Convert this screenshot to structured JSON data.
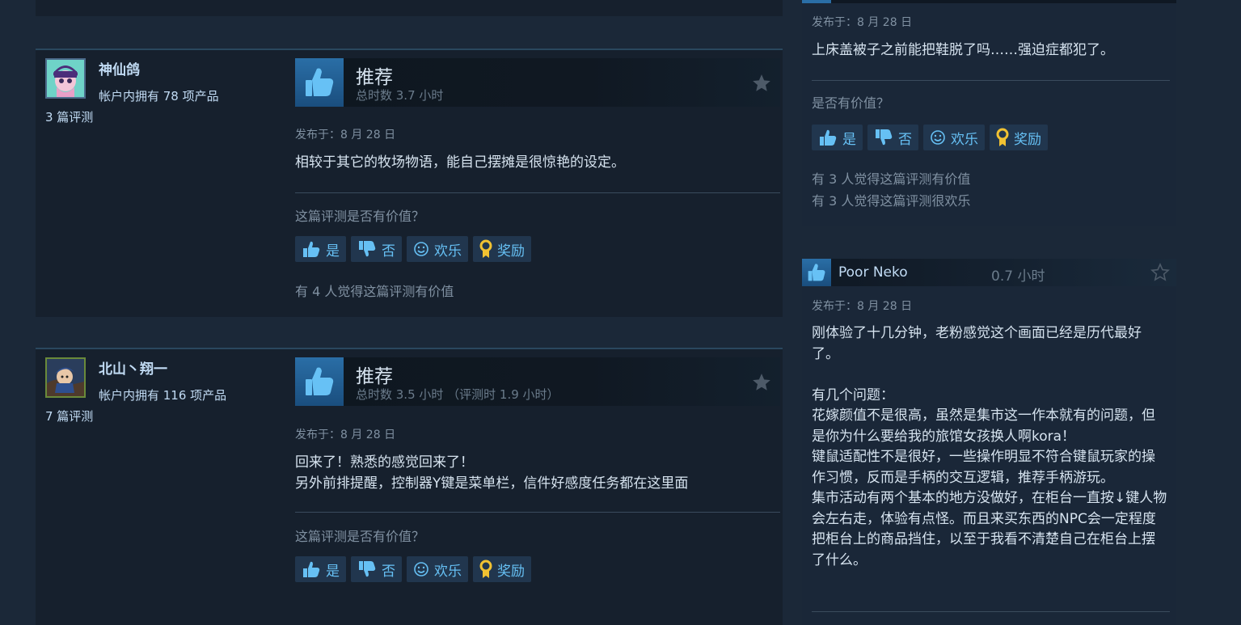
{
  "colors": {
    "background": "#1b2838",
    "card": "#16202d",
    "accent_blue": "#66c0f4",
    "award_gold": "#f1c232"
  },
  "reviews": [
    {
      "persona": "神仙鸽",
      "owned": "帐户内拥有 78 项产品",
      "review_count": "3 篇评测",
      "verdict": "推荐",
      "hours": "总时数 3.7 小时",
      "posted": "发布于：8 月 28 日",
      "body": "相较于其它的牧场物语，能自己摆摊是很惊艳的设定。",
      "helpful_question": "这篇评测是否有价值？",
      "buttons": {
        "yes": "是",
        "no": "否",
        "funny": "欢乐",
        "award": "奖励"
      },
      "helpful_count": "有 4 人觉得这篇评测有价值"
    },
    {
      "persona": "北山丶翔一",
      "owned": "帐户内拥有 116 项产品",
      "review_count": "7 篇评测",
      "verdict": "推荐",
      "hours": "总时数 3.5 小时 （评测时 1.9 小时）",
      "posted": "发布于：8 月 28 日",
      "body": "回来了！熟悉的感觉回来了！\n另外前排提醒，控制器Y键是菜单栏，信件好感度任务都在这里面",
      "helpful_question": "这篇评测是否有价值？",
      "buttons": {
        "yes": "是",
        "no": "否",
        "funny": "欢乐",
        "award": "奖励"
      }
    }
  ],
  "side_reviews": [
    {
      "posted": "发布于：8 月 28 日",
      "body": "上床盖被子之前能把鞋脱了吗……强迫症都犯了。",
      "helpful_question": "是否有价值？",
      "buttons": {
        "yes": "是",
        "no": "否",
        "funny": "欢乐",
        "award": "奖励"
      },
      "helpful_count": "有 3 人觉得这篇评测有价值",
      "funny_count": "有 3 人觉得这篇评测很欢乐"
    },
    {
      "persona": "Poor Neko",
      "hours": "0.7 小时",
      "posted": "发布于：8 月 28 日",
      "body": "刚体验了十几分钟，老粉感觉这个画面已经是历代最好了。\n\n有几个问题：\n花嫁颜值不是很高，虽然是集市这一作本就有的问题，但是你为什么要给我的旅馆女孩换人啊kora！\n键鼠适配性不是很好，一些操作明显不符合键鼠玩家的操作习惯，反而是手柄的交互逻辑，推荐手柄游玩。\n集市活动有两个基本的地方没做好，在柜台一直按↓键人物会左右走，体验有点怪。而且来买东西的NPC会一定程度把柜台上的商品挡住，以至于我看不清楚自己在柜台上摆了什么。"
    }
  ]
}
